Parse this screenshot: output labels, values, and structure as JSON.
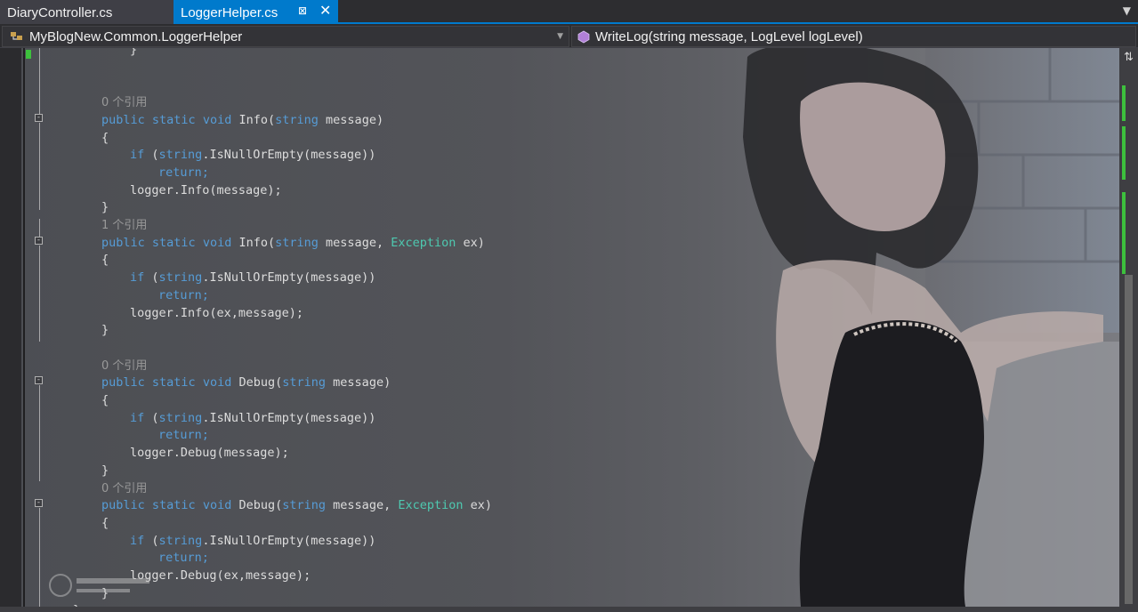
{
  "tabs": [
    {
      "label": "DiaryController.cs",
      "active": false
    },
    {
      "label": "LoggerHelper.cs",
      "active": true
    }
  ],
  "tab_icons": {
    "pin": "pin-icon",
    "close": "close-icon",
    "overflow": "dropdown-overflow-icon"
  },
  "navbar": {
    "type_label": "MyBlogNew.Common.LoggerHelper",
    "member_label": "WriteLog(string message, LogLevel logLevel)"
  },
  "colors": {
    "accent": "#007acc",
    "keyword": "#569cd6",
    "type": "#4ec9b0",
    "change_marker": "#3dc13d"
  },
  "code": {
    "lines": [
      {
        "kind": "plain",
        "text": "}"
      },
      {
        "kind": "blank"
      },
      {
        "kind": "blank"
      },
      {
        "kind": "ref",
        "text": "0 个引用"
      },
      {
        "kind": "sig",
        "name": "Info",
        "params": [
          {
            "type": "string",
            "name": "message"
          }
        ]
      },
      {
        "kind": "plain",
        "text": "{"
      },
      {
        "kind": "if"
      },
      {
        "kind": "return"
      },
      {
        "kind": "call",
        "text": "logger.Info(message);"
      },
      {
        "kind": "plain",
        "text": "}"
      },
      {
        "kind": "ref",
        "text": "1 个引用"
      },
      {
        "kind": "sig",
        "name": "Info",
        "params": [
          {
            "type": "string",
            "name": "message"
          },
          {
            "type": "Exception",
            "name": "ex"
          }
        ]
      },
      {
        "kind": "plain",
        "text": "{"
      },
      {
        "kind": "if"
      },
      {
        "kind": "return"
      },
      {
        "kind": "call",
        "text": "logger.Info(ex,message);"
      },
      {
        "kind": "plain",
        "text": "}"
      },
      {
        "kind": "blank"
      },
      {
        "kind": "ref",
        "text": "0 个引用"
      },
      {
        "kind": "sig",
        "name": "Debug",
        "params": [
          {
            "type": "string",
            "name": "message"
          }
        ]
      },
      {
        "kind": "plain",
        "text": "{"
      },
      {
        "kind": "if"
      },
      {
        "kind": "return"
      },
      {
        "kind": "call",
        "text": "logger.Debug(message);"
      },
      {
        "kind": "plain",
        "text": "}"
      },
      {
        "kind": "ref",
        "text": "0 个引用"
      },
      {
        "kind": "sig",
        "name": "Debug",
        "params": [
          {
            "type": "string",
            "name": "message"
          },
          {
            "type": "Exception",
            "name": "ex"
          }
        ]
      },
      {
        "kind": "plain",
        "text": "{"
      },
      {
        "kind": "if"
      },
      {
        "kind": "return"
      },
      {
        "kind": "call",
        "text": "logger.Debug(ex,message);"
      },
      {
        "kind": "plain",
        "text": "}"
      },
      {
        "kind": "plain",
        "text": "}"
      }
    ],
    "tokens": {
      "public": "public",
      "static": "static",
      "void": "void",
      "if": "if",
      "return": "return;",
      "string_kw": "string",
      "is_null": ".IsNullOrEmpty(message))"
    }
  }
}
